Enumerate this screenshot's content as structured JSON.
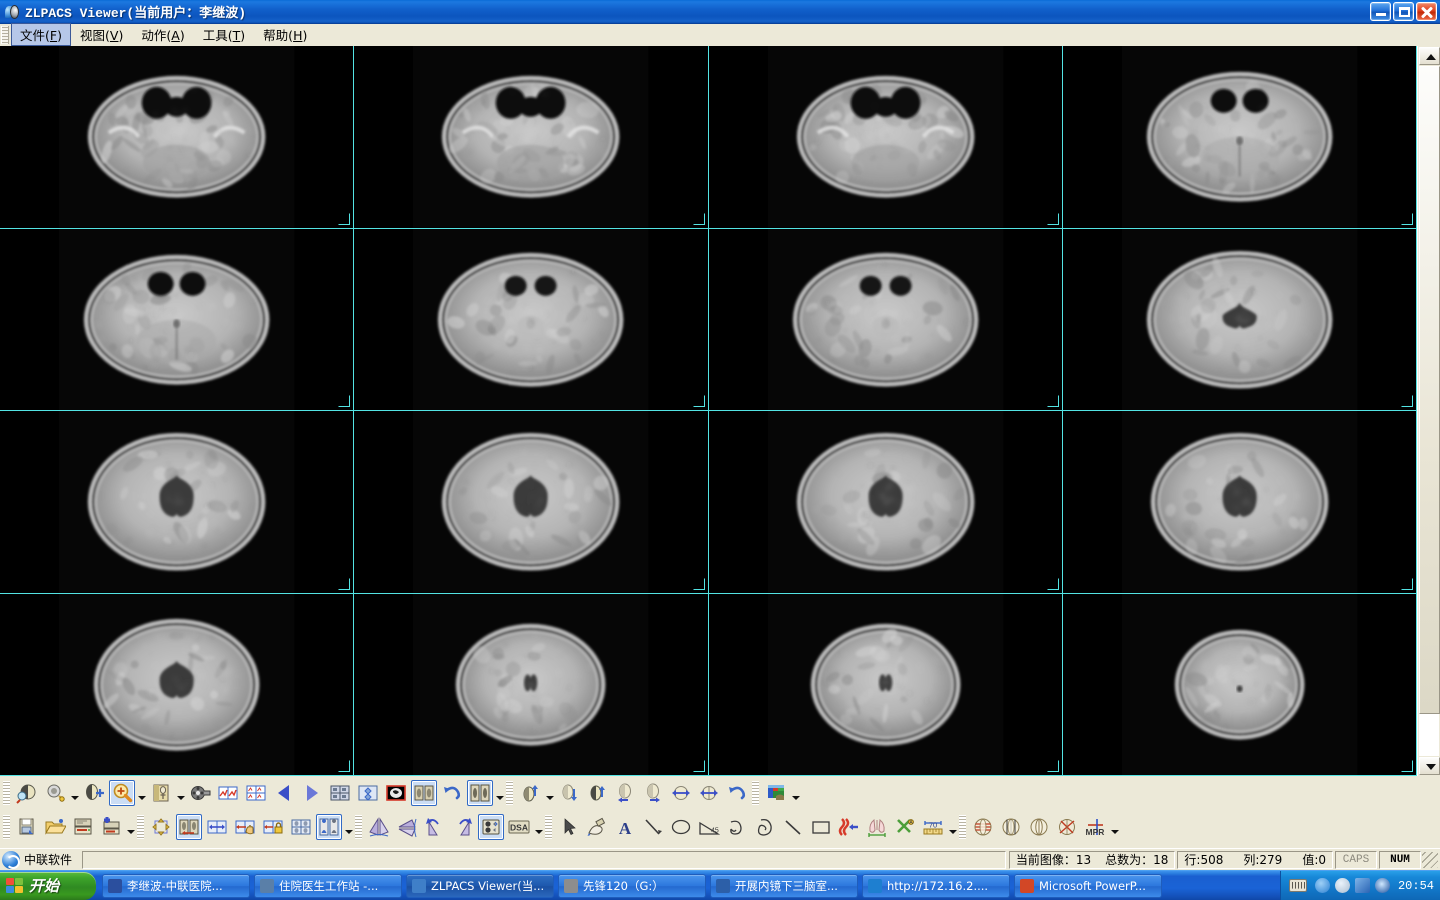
{
  "window": {
    "title": "ZLPACS Viewer(当前用户：李继波)",
    "icon": "zlpacs-app-icon",
    "buttons": {
      "minimize": "minimize-button",
      "maximize": "maximize-button",
      "close": "close-button"
    }
  },
  "menubar": {
    "items": [
      {
        "label": "文件",
        "hotkey": "F",
        "active": true
      },
      {
        "label": "视图",
        "hotkey": "V",
        "active": false
      },
      {
        "label": "动作",
        "hotkey": "A",
        "active": false
      },
      {
        "label": "工具",
        "hotkey": "T",
        "active": false
      },
      {
        "label": "帮助",
        "hotkey": "H",
        "active": false
      }
    ]
  },
  "viewer": {
    "layout": "4x4",
    "border_color": "#53E3E3",
    "background": "#000000",
    "cells": [
      {
        "index": 1,
        "slice_kind": "skull-base",
        "selected": false
      },
      {
        "index": 2,
        "slice_kind": "skull-base",
        "selected": false
      },
      {
        "index": 3,
        "slice_kind": "skull-base",
        "selected": false
      },
      {
        "index": 4,
        "slice_kind": "posterior-fossa",
        "selected": false
      },
      {
        "index": 5,
        "slice_kind": "posterior-fossa",
        "selected": false
      },
      {
        "index": 6,
        "slice_kind": "midbrain",
        "selected": false
      },
      {
        "index": 7,
        "slice_kind": "midbrain",
        "selected": false
      },
      {
        "index": 8,
        "slice_kind": "basal-ganglia",
        "selected": false
      },
      {
        "index": 9,
        "slice_kind": "ventricles",
        "selected": false
      },
      {
        "index": 10,
        "slice_kind": "ventricles",
        "selected": false
      },
      {
        "index": 11,
        "slice_kind": "ventricles",
        "selected": false
      },
      {
        "index": 12,
        "slice_kind": "ventricles",
        "selected": false
      },
      {
        "index": 13,
        "slice_kind": "high-ventricles",
        "selected": false
      },
      {
        "index": 14,
        "slice_kind": "centrum",
        "selected": false
      },
      {
        "index": 15,
        "slice_kind": "centrum",
        "selected": false
      },
      {
        "index": 16,
        "slice_kind": "vertex",
        "selected": false
      }
    ],
    "scrollbar": {
      "orientation": "vertical",
      "position": "top"
    }
  },
  "toolbar_row1": [
    {
      "name": "window-level-tool",
      "icon": "contrast-brightness",
      "pressed": false,
      "dropdown": false
    },
    {
      "name": "brightness-tool",
      "icon": "brightness",
      "pressed": false,
      "dropdown": true
    },
    {
      "name": "invert-tool",
      "icon": "invert-image",
      "pressed": false,
      "dropdown": false
    },
    {
      "name": "zoom-tool",
      "icon": "magnifier-plus",
      "pressed": true,
      "dropdown": true
    },
    {
      "name": "preset-window-tool",
      "icon": "body-preset",
      "pressed": false,
      "dropdown": true
    },
    {
      "name": "cine-play-tool",
      "icon": "film-reel",
      "pressed": false,
      "dropdown": false
    },
    {
      "name": "compare-2-tool",
      "icon": "two-pane-compare",
      "pressed": false,
      "dropdown": false
    },
    {
      "name": "compare-4-tool",
      "icon": "four-pane-compare",
      "pressed": false,
      "dropdown": false
    },
    {
      "name": "previous-image-button",
      "icon": "arrow-left-solid",
      "pressed": false,
      "dropdown": false
    },
    {
      "name": "next-image-button",
      "icon": "arrow-right-solid",
      "pressed": false,
      "dropdown": false
    },
    {
      "name": "layout-grid-tool",
      "icon": "grid-layout",
      "pressed": false,
      "dropdown": false
    },
    {
      "name": "layout-tile-tool",
      "icon": "tile-layout",
      "pressed": false,
      "dropdown": false
    },
    {
      "name": "fit-window-tool",
      "icon": "fit-to-window",
      "pressed": false,
      "dropdown": false
    },
    {
      "name": "reference-tool",
      "icon": "reference-image",
      "pressed": true,
      "dropdown": false
    },
    {
      "name": "undo-action-button",
      "icon": "undo-arrow",
      "pressed": false,
      "dropdown": false
    },
    {
      "name": "stack-pair-tool",
      "icon": "two-image-stack",
      "pressed": true,
      "dropdown": true
    },
    {
      "name": "flip-up-tool",
      "icon": "flip-up",
      "pressed": false,
      "dropdown": true
    },
    {
      "name": "flip-down-tool",
      "icon": "flip-down",
      "pressed": false,
      "dropdown": false
    },
    {
      "name": "flip-vertical-tool",
      "icon": "flip-vertical",
      "pressed": false,
      "dropdown": false
    },
    {
      "name": "shift-left-tool",
      "icon": "shift-left",
      "pressed": false,
      "dropdown": false
    },
    {
      "name": "shift-right-tool",
      "icon": "shift-right",
      "pressed": false,
      "dropdown": false
    },
    {
      "name": "pan-horizontal-tool",
      "icon": "pan-horizontal",
      "pressed": false,
      "dropdown": false
    },
    {
      "name": "expand-horizontal-tool",
      "icon": "expand-horizontal",
      "pressed": false,
      "dropdown": false
    },
    {
      "name": "rotate-reset-button",
      "icon": "undo-arrow",
      "pressed": false,
      "dropdown": false
    },
    {
      "name": "color-map-tool",
      "icon": "color-palette",
      "pressed": false,
      "dropdown": true
    }
  ],
  "toolbar_row2": [
    {
      "name": "save-study-button",
      "icon": "save-disk",
      "pressed": false,
      "dropdown": false
    },
    {
      "name": "open-folder-button",
      "icon": "open-folder",
      "pressed": false,
      "dropdown": false
    },
    {
      "name": "archive-button",
      "icon": "server-archive",
      "pressed": false,
      "dropdown": false
    },
    {
      "name": "add-server-button",
      "icon": "server-add",
      "pressed": false,
      "dropdown": true
    },
    {
      "name": "select-tool",
      "icon": "move-handles",
      "pressed": false,
      "dropdown": false
    },
    {
      "name": "sync-images-tool",
      "icon": "sync-two-images",
      "pressed": true,
      "dropdown": false
    },
    {
      "name": "link-scroll-tool",
      "icon": "link-pan",
      "pressed": false,
      "dropdown": false
    },
    {
      "name": "hand-pan-tool",
      "icon": "hand-pan",
      "pressed": false,
      "dropdown": false
    },
    {
      "name": "lock-pane-tool",
      "icon": "lock-pane",
      "pressed": false,
      "dropdown": false
    },
    {
      "name": "thumbnail-grid-tool",
      "icon": "thumbnail-grid",
      "pressed": false,
      "dropdown": false
    },
    {
      "name": "patient-compare-tool",
      "icon": "patient-compare",
      "pressed": true,
      "dropdown": true
    },
    {
      "name": "mirror-horizontal-tool",
      "icon": "mirror-horizontal",
      "pressed": false,
      "dropdown": false
    },
    {
      "name": "mirror-vertical-tool",
      "icon": "mirror-vertical",
      "pressed": false,
      "dropdown": false
    },
    {
      "name": "rotate-ccw-tool",
      "icon": "rotate-ccw",
      "pressed": false,
      "dropdown": false
    },
    {
      "name": "rotate-cw-tool",
      "icon": "rotate-cw",
      "pressed": false,
      "dropdown": false
    },
    {
      "name": "subtraction-tool",
      "icon": "subtract-images",
      "pressed": true,
      "dropdown": false
    },
    {
      "name": "dsa-tool",
      "icon": "dsa-label",
      "label": "DSA",
      "pressed": false,
      "dropdown": true
    },
    {
      "name": "pointer-tool",
      "icon": "arrow-pointer",
      "pressed": false,
      "dropdown": false
    },
    {
      "name": "freehand-draw-tool",
      "icon": "pencil-draw",
      "pressed": false,
      "dropdown": false
    },
    {
      "name": "text-annotation-tool",
      "icon": "text-a",
      "label": "A",
      "pressed": false,
      "dropdown": false
    },
    {
      "name": "line-measure-tool",
      "icon": "line-measure",
      "pressed": false,
      "dropdown": false
    },
    {
      "name": "ellipse-roi-tool",
      "icon": "ellipse-roi",
      "pressed": false,
      "dropdown": false
    },
    {
      "name": "angle-measure-tool",
      "icon": "angle-45",
      "label": "45",
      "pressed": false,
      "dropdown": false
    },
    {
      "name": "curve-roi-tool",
      "icon": "curve-roi",
      "pressed": false,
      "dropdown": false
    },
    {
      "name": "polygon-roi-tool",
      "icon": "polygon-roi",
      "pressed": false,
      "dropdown": false
    },
    {
      "name": "arrow-line-tool",
      "icon": "diagonal-line",
      "pressed": false,
      "dropdown": false
    },
    {
      "name": "rectangle-roi-tool",
      "icon": "rectangle-roi",
      "pressed": false,
      "dropdown": false
    },
    {
      "name": "spine-marker-tool",
      "icon": "spine-marker",
      "pressed": false,
      "dropdown": false
    },
    {
      "name": "lung-measure-tool",
      "icon": "lung-measure",
      "pressed": false,
      "dropdown": false
    },
    {
      "name": "delete-annotation-tool",
      "icon": "scissors-delete",
      "pressed": false,
      "dropdown": false
    },
    {
      "name": "ruler-tool",
      "icon": "ruler-70",
      "label": "70",
      "pressed": false,
      "dropdown": true
    },
    {
      "name": "mpr-axial-tool",
      "icon": "mpr-axial",
      "pressed": false,
      "dropdown": false
    },
    {
      "name": "mpr-coronal-tool",
      "icon": "mpr-coronal",
      "pressed": false,
      "dropdown": false
    },
    {
      "name": "mpr-sagittal-tool",
      "icon": "mpr-sagittal",
      "pressed": false,
      "dropdown": false
    },
    {
      "name": "mpr-oblique-tool",
      "icon": "mpr-oblique",
      "pressed": false,
      "dropdown": false
    },
    {
      "name": "mpr-button",
      "icon": "mpr-crosshair",
      "label": "MPR",
      "pressed": false,
      "dropdown": true
    }
  ],
  "statusbar": {
    "brand": "中联软件",
    "current_image_label": "当前图像：13",
    "total_label": "总数为：18",
    "row_label": "行:508",
    "col_label": "列:279",
    "value_label": "值:0",
    "caps": "CAPS",
    "num": "NUM"
  },
  "taskbar": {
    "start_label": "开始",
    "tasks": [
      {
        "label": "李继波-中联医院...",
        "icon_color": "#2b4f9e",
        "active": false,
        "name": "taskbar-item-patient-record"
      },
      {
        "label": "住院医生工作站 -...",
        "icon_color": "#5a7fa8",
        "active": false,
        "name": "taskbar-item-doctor-workstation"
      },
      {
        "label": "ZLPACS Viewer(当...",
        "icon_color": "#3f7fc8",
        "active": true,
        "name": "taskbar-item-zlpacs-viewer"
      },
      {
        "label": "先锋120（G:）",
        "icon_color": "#8d8d8d",
        "active": false,
        "name": "taskbar-item-drive-g"
      },
      {
        "label": "开展内镜下三脑室...",
        "icon_color": "#2c5fa8",
        "active": false,
        "name": "taskbar-item-word-doc"
      },
      {
        "label": "http://172.16.2....",
        "icon_color": "#1e7fd0",
        "active": false,
        "name": "taskbar-item-browser"
      },
      {
        "label": "Microsoft PowerP...",
        "icon_color": "#d24726",
        "active": false,
        "name": "taskbar-item-powerpoint"
      }
    ],
    "tray": {
      "time": "20:54",
      "icons": [
        "show-hidden-icons",
        "protection-icon",
        "network-icon",
        "audio-monitor-icon"
      ],
      "keyboard": "language-bar-icon"
    }
  }
}
